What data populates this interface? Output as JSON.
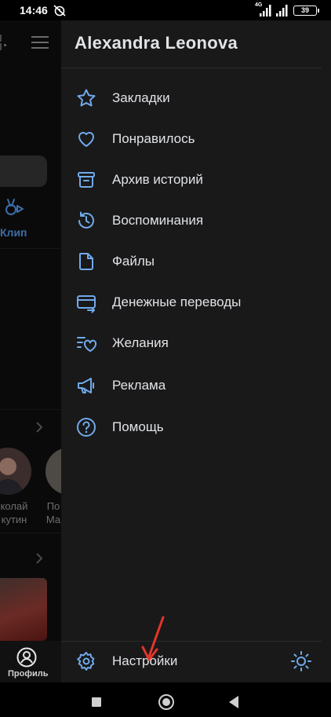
{
  "status_bar": {
    "time": "14:46",
    "network": "4G",
    "battery": "39"
  },
  "background_app": {
    "clip_label": "Клип",
    "friends": [
      {
        "line1": "колай",
        "line2": "кутин"
      },
      {
        "line1": "По",
        "line2": "Ма"
      }
    ],
    "tab_label": "Профиль"
  },
  "drawer": {
    "user_name": "Alexandra Leonova",
    "items": [
      {
        "id": "bookmarks",
        "label": "Закладки",
        "icon": "star-icon"
      },
      {
        "id": "liked",
        "label": "Понравилось",
        "icon": "heart-icon"
      },
      {
        "id": "stories-archive",
        "label": "Архив историй",
        "icon": "archive-icon"
      },
      {
        "id": "memories",
        "label": "Воспоминания",
        "icon": "history-icon"
      },
      {
        "id": "files",
        "label": "Файлы",
        "icon": "file-icon"
      },
      {
        "id": "money-transfers",
        "label": "Денежные переводы",
        "icon": "card-transfer-icon"
      },
      {
        "id": "wishes",
        "label": "Желания",
        "icon": "wishlist-icon"
      },
      {
        "id": "ads",
        "label": "Реклама",
        "icon": "megaphone-icon"
      },
      {
        "id": "help",
        "label": "Помощь",
        "icon": "help-icon"
      }
    ],
    "settings_label": "Настройки",
    "accent_color": "#71aaeb"
  }
}
